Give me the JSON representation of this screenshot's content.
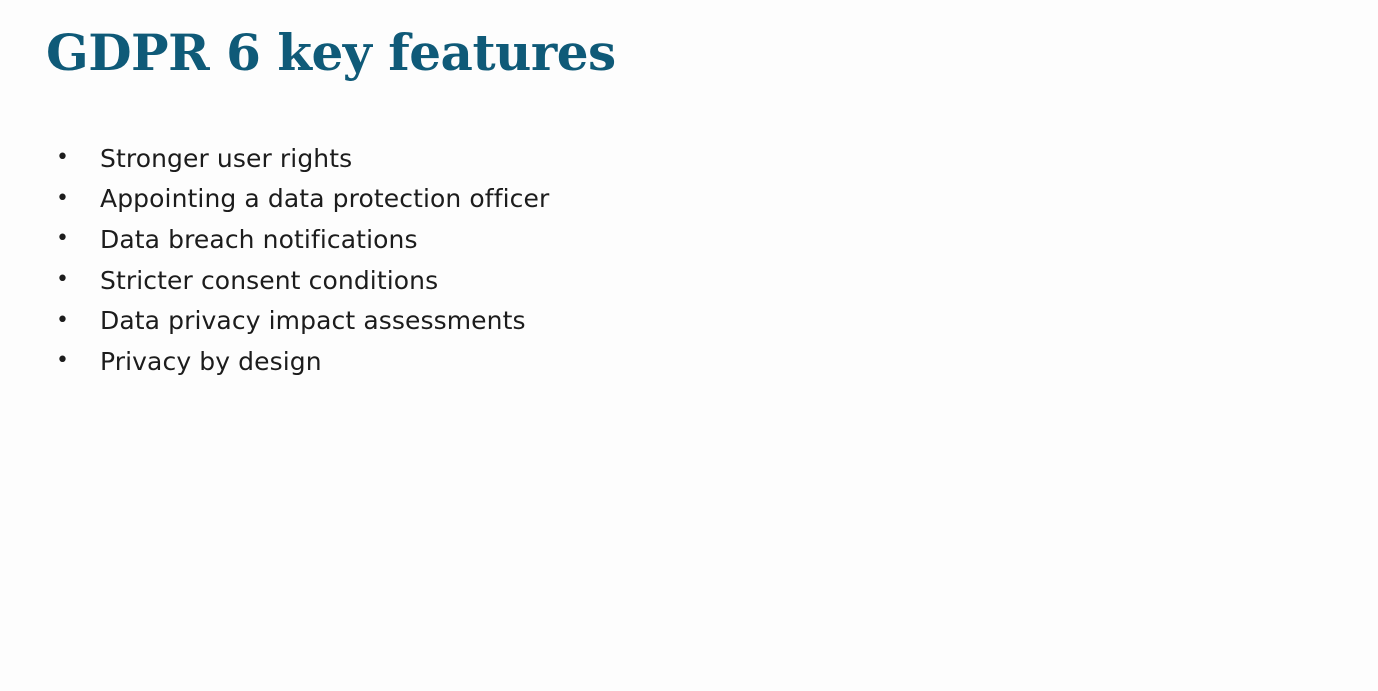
{
  "slide": {
    "title": "GDPR 6 key features",
    "title_color": "#0f5a78",
    "bullet_glyph": "•",
    "bullets": [
      "Stronger user rights",
      "Appointing a data protection officer",
      "Data breach notifications",
      "Stricter consent conditions",
      "Data privacy impact assessments",
      "Privacy by design"
    ]
  }
}
